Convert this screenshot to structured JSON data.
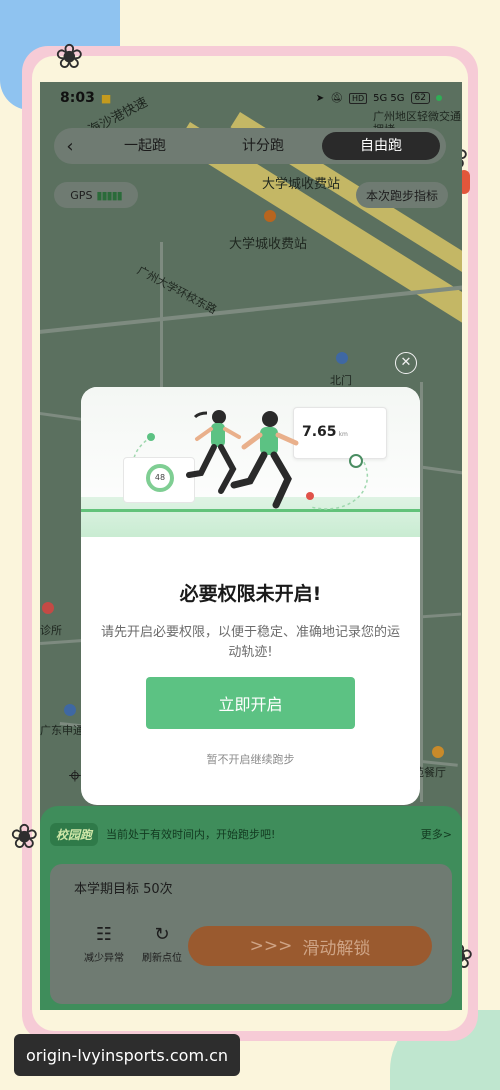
{
  "status_bar": {
    "time": "8:03",
    "network": "5G 5G",
    "hd": "HD",
    "battery": "62"
  },
  "top_tabs": {
    "back_icon": "chevron-left-icon",
    "items": [
      {
        "label": "一起跑"
      },
      {
        "label": "计分跑"
      },
      {
        "label": "自由跑",
        "active": true
      }
    ]
  },
  "map": {
    "gps_label": "GPS",
    "stats_label": "本次跑步指标",
    "labels": {
      "road_1": "海沙港快速",
      "toll_1": "大学城收费站",
      "toll_2": "大学城收费站",
      "road_2": "广州大学环校东路",
      "north_gate": "北门",
      "district": "广州地区轻微交通拥堵",
      "clinic": "诊所",
      "road_3": "广东申通",
      "restaurant": "梅苑餐厅"
    }
  },
  "modal": {
    "close_icon": "close-icon",
    "distance_value": "7.65",
    "distance_unit": "km",
    "ring_value": "48",
    "title": "必要权限未开启!",
    "description": "请先开启必要权限，以便于稳定、准确地记录您的运动轨迹!",
    "primary_button": "立即开启",
    "secondary_link": "暂不开启继续跑步"
  },
  "bottom_panel": {
    "notice_badge": "校园跑",
    "notice_text": "当前处于有效时间内，开始跑步吧!",
    "notice_more": "更多>",
    "goal_text": "本学期目标 50次",
    "action_1": "减少异常",
    "action_2": "刷新点位",
    "slide_label": "滑动解锁",
    "slide_arrows": ">>>"
  },
  "watermark": {
    "text": "origin-lvyinsports.com.cn"
  },
  "colors": {
    "accent_green": "#5cc283",
    "panel_green": "#3f8d5b",
    "slide_orange": "#9a5a2f",
    "frame_pink": "#f6cbd6"
  }
}
